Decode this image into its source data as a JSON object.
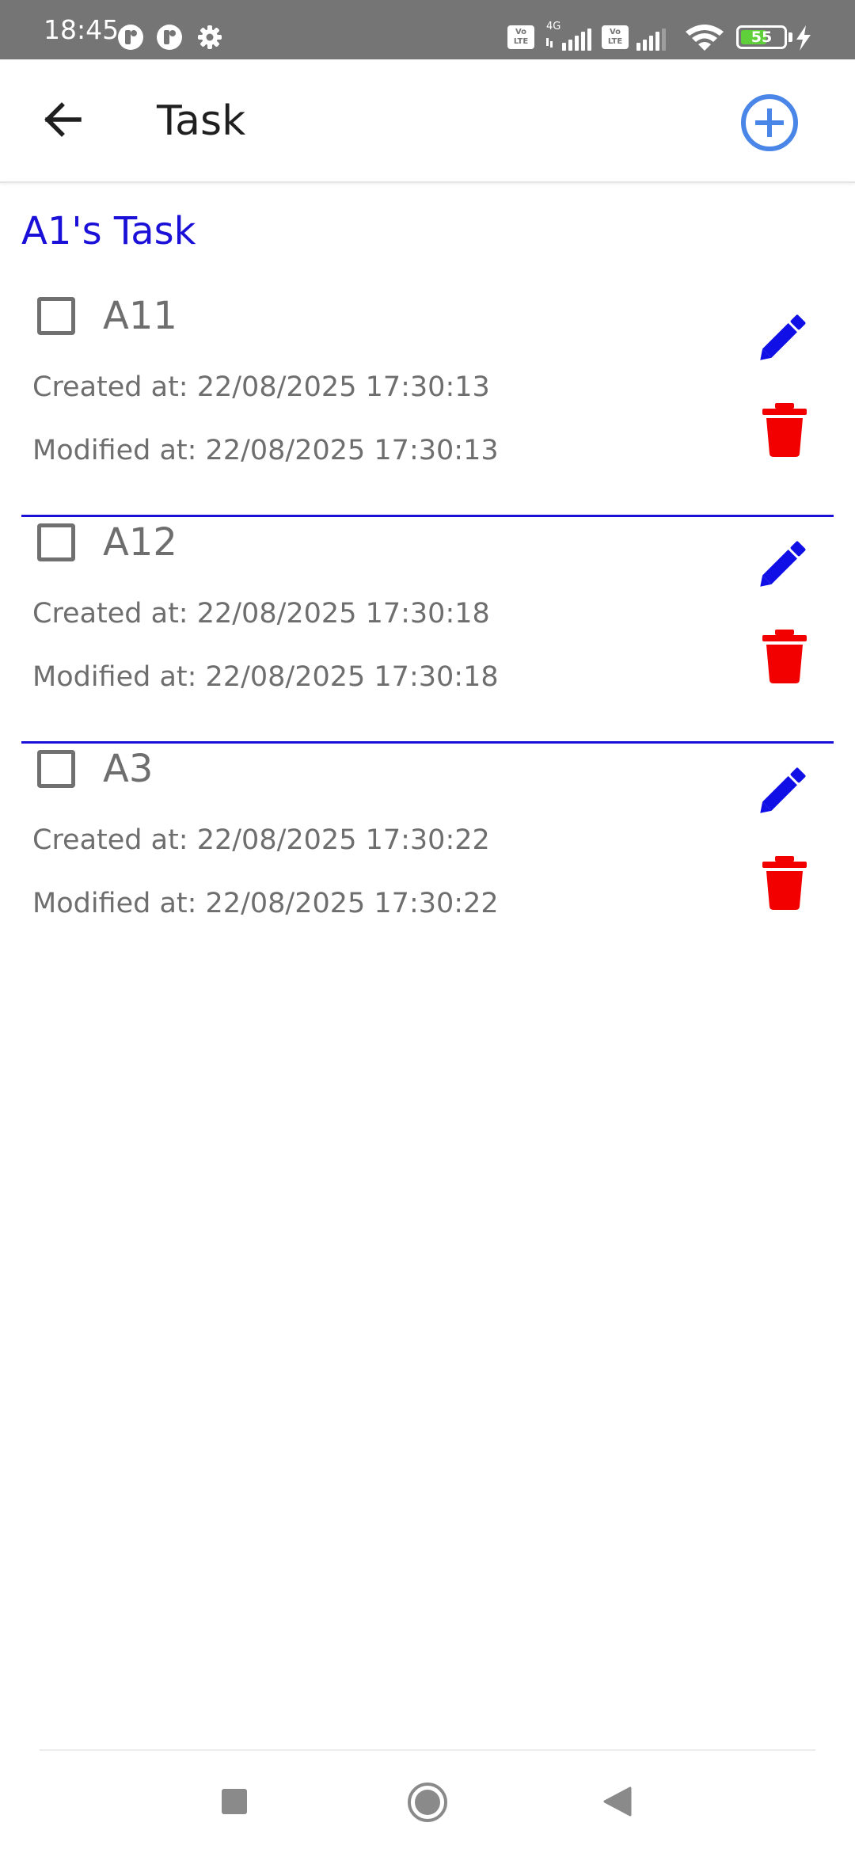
{
  "status_bar": {
    "time": "18:45",
    "network_type": "4G",
    "volte_label": "Vo LTE",
    "battery_level": "55",
    "icons": [
      "notification-app-icon",
      "notification-app-icon",
      "settings-gear-icon",
      "volte-icon",
      "signal-icon",
      "volte-icon",
      "signal-icon",
      "wifi-icon",
      "battery-icon",
      "charging-bolt-icon"
    ]
  },
  "app_bar": {
    "title": "Task",
    "back_icon": "arrow-back-icon",
    "add_icon": "add-circle-icon"
  },
  "list": {
    "title": "A1's Task",
    "tasks": [
      {
        "name": "A11",
        "created": "Created at: 22/08/2025 17:30:13",
        "modified": "Modified at: 22/08/2025 17:30:13",
        "checked": false
      },
      {
        "name": "A12",
        "created": "Created at: 22/08/2025 17:30:18",
        "modified": "Modified at: 22/08/2025 17:30:18",
        "checked": false
      },
      {
        "name": "A3",
        "created": "Created at: 22/08/2025 17:30:22",
        "modified": "Modified at: 22/08/2025 17:30:22",
        "checked": false
      }
    ]
  },
  "nav_bar": {
    "icons": [
      "recents-square-icon",
      "home-circle-icon",
      "back-triangle-icon"
    ]
  },
  "colors": {
    "accent_blue": "#1a10d8",
    "edit_blue": "#1010e6",
    "delete_red": "#f20000",
    "add_blue": "#4a86e8",
    "status_bar": "#757575"
  }
}
